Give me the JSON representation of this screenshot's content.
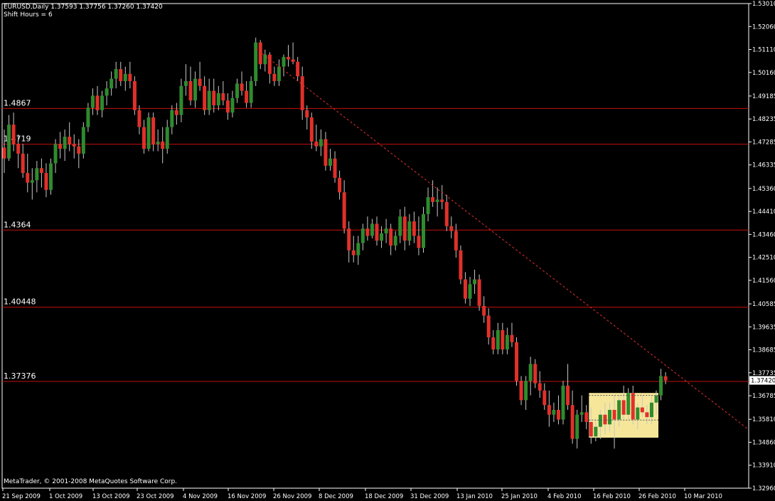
{
  "header": {
    "symbol_line": "EURUSD,Daily  1.37593 1.37756 1.37260 1.37420",
    "shift_line": "Shift Hours = 6"
  },
  "footer": {
    "copyright": "MetaTrader, © 2001-2008 MetaQuotes Software Corp."
  },
  "colors": {
    "background": "#000000",
    "axis": "#ffffff",
    "bull": "#2e8b2e",
    "bear": "#e0302a",
    "wick": "#c8c8c8",
    "hline": "#c41010",
    "trendline": "#e03030",
    "highlight": "#f5e69a",
    "label": "#ffffff"
  },
  "chart_data": {
    "type": "candlestick",
    "ylim": [
      1.3296,
      1.5301
    ],
    "y_ticks": [
      "1.53010",
      "1.52060",
      "1.51110",
      "1.50160",
      "1.49185",
      "1.48235",
      "1.47285",
      "1.46335",
      "1.45360",
      "1.44410",
      "1.43460",
      "1.42510",
      "1.41560",
      "1.40585",
      "1.39635",
      "1.38685",
      "1.37735",
      "1.36785",
      "1.35810",
      "1.34860",
      "1.33910",
      "1.32960"
    ],
    "current_price": "1.37420",
    "x_ticks": [
      "21 Sep 2009",
      "1 Oct 2009",
      "13 Oct 2009",
      "23 Oct 2009",
      "4 Nov 2009",
      "16 Nov 2009",
      "26 Nov 2009",
      "8 Dec 2009",
      "18 Dec 2009",
      "31 Dec 2009",
      "13 Jan 2010",
      "25 Jan 2010",
      "4 Feb 2010",
      "16 Feb 2010",
      "26 Feb 2010",
      "10 Mar 2010"
    ],
    "horizontal_lines": [
      {
        "value": 1.4867,
        "label": "1.4867"
      },
      {
        "value": 1.4719,
        "label": "1.4719"
      },
      {
        "value": 1.4364,
        "label": "1.4364"
      },
      {
        "value": 1.40448,
        "label": "1.40448"
      },
      {
        "value": 1.37376,
        "label": "1.37376"
      }
    ],
    "trendline": {
      "from": {
        "bar": 54,
        "price": 1.5115
      },
      "to": {
        "bar": 149,
        "price": 1.37
      }
    },
    "highlight_box": {
      "from_bar": 126,
      "to_bar": 140,
      "top": 1.369,
      "bottom": 1.3505
    },
    "candles": [
      [
        1.4705,
        1.478,
        1.46,
        1.466
      ],
      [
        1.466,
        1.484,
        1.465,
        1.48
      ],
      [
        1.48,
        1.485,
        1.469,
        1.472
      ],
      [
        1.472,
        1.476,
        1.462,
        1.468
      ],
      [
        1.468,
        1.472,
        1.458,
        1.46
      ],
      [
        1.46,
        1.468,
        1.452,
        1.456
      ],
      [
        1.456,
        1.462,
        1.449,
        1.457
      ],
      [
        1.457,
        1.465,
        1.452,
        1.462
      ],
      [
        1.462,
        1.466,
        1.454,
        1.46
      ],
      [
        1.46,
        1.464,
        1.45,
        1.453
      ],
      [
        1.453,
        1.466,
        1.451,
        1.464
      ],
      [
        1.464,
        1.474,
        1.46,
        1.472
      ],
      [
        1.472,
        1.477,
        1.466,
        1.47
      ],
      [
        1.47,
        1.478,
        1.465,
        1.475
      ],
      [
        1.475,
        1.481,
        1.469,
        1.472
      ],
      [
        1.472,
        1.476,
        1.466,
        1.471
      ],
      [
        1.471,
        1.474,
        1.462,
        1.468
      ],
      [
        1.468,
        1.481,
        1.466,
        1.479
      ],
      [
        1.479,
        1.489,
        1.477,
        1.487
      ],
      [
        1.487,
        1.495,
        1.484,
        1.492
      ],
      [
        1.492,
        1.496,
        1.484,
        1.486
      ],
      [
        1.486,
        1.494,
        1.483,
        1.492
      ],
      [
        1.492,
        1.498,
        1.488,
        1.495
      ],
      [
        1.495,
        1.502,
        1.492,
        1.499
      ],
      [
        1.499,
        1.506,
        1.495,
        1.503
      ],
      [
        1.503,
        1.506,
        1.496,
        1.498
      ],
      [
        1.498,
        1.504,
        1.494,
        1.501
      ],
      [
        1.501,
        1.506,
        1.495,
        1.498
      ],
      [
        1.498,
        1.5,
        1.484,
        1.486
      ],
      [
        1.486,
        1.488,
        1.476,
        1.479
      ],
      [
        1.479,
        1.482,
        1.468,
        1.47
      ],
      [
        1.47,
        1.485,
        1.469,
        1.483
      ],
      [
        1.483,
        1.485,
        1.469,
        1.472
      ],
      [
        1.472,
        1.478,
        1.469,
        1.473
      ],
      [
        1.473,
        1.479,
        1.464,
        1.47
      ],
      [
        1.47,
        1.482,
        1.468,
        1.479
      ],
      [
        1.479,
        1.488,
        1.476,
        1.486
      ],
      [
        1.486,
        1.489,
        1.48,
        1.484
      ],
      [
        1.484,
        1.499,
        1.481,
        1.496
      ],
      [
        1.496,
        1.505,
        1.492,
        1.498
      ],
      [
        1.498,
        1.504,
        1.488,
        1.49
      ],
      [
        1.49,
        1.502,
        1.487,
        1.499
      ],
      [
        1.499,
        1.506,
        1.494,
        1.496
      ],
      [
        1.496,
        1.5,
        1.484,
        1.486
      ],
      [
        1.486,
        1.499,
        1.484,
        1.494
      ],
      [
        1.494,
        1.499,
        1.485,
        1.488
      ],
      [
        1.488,
        1.496,
        1.486,
        1.493
      ],
      [
        1.493,
        1.498,
        1.488,
        1.49
      ],
      [
        1.49,
        1.493,
        1.482,
        1.485
      ],
      [
        1.485,
        1.494,
        1.483,
        1.491
      ],
      [
        1.491,
        1.499,
        1.489,
        1.497
      ],
      [
        1.497,
        1.502,
        1.492,
        1.494
      ],
      [
        1.494,
        1.498,
        1.487,
        1.489
      ],
      [
        1.489,
        1.5,
        1.487,
        1.498
      ],
      [
        1.498,
        1.516,
        1.496,
        1.514
      ],
      [
        1.514,
        1.515,
        1.503,
        1.505
      ],
      [
        1.505,
        1.511,
        1.502,
        1.509
      ],
      [
        1.509,
        1.51,
        1.497,
        1.501
      ],
      [
        1.501,
        1.504,
        1.496,
        1.498
      ],
      [
        1.498,
        1.507,
        1.496,
        1.504
      ],
      [
        1.504,
        1.509,
        1.5,
        1.508
      ],
      [
        1.508,
        1.513,
        1.504,
        1.507
      ],
      [
        1.507,
        1.514,
        1.505,
        1.506
      ],
      [
        1.506,
        1.508,
        1.498,
        1.5
      ],
      [
        1.5,
        1.504,
        1.482,
        1.486
      ],
      [
        1.486,
        1.488,
        1.478,
        1.483
      ],
      [
        1.483,
        1.485,
        1.47,
        1.473
      ],
      [
        1.473,
        1.48,
        1.469,
        1.471
      ],
      [
        1.471,
        1.478,
        1.467,
        1.474
      ],
      [
        1.474,
        1.477,
        1.461,
        1.463
      ],
      [
        1.463,
        1.47,
        1.461,
        1.466
      ],
      [
        1.466,
        1.469,
        1.456,
        1.458
      ],
      [
        1.458,
        1.461,
        1.449,
        1.452
      ],
      [
        1.452,
        1.457,
        1.435,
        1.437
      ],
      [
        1.437,
        1.44,
        1.423,
        1.428
      ],
      [
        1.428,
        1.434,
        1.423,
        1.426
      ],
      [
        1.426,
        1.434,
        1.422,
        1.431
      ],
      [
        1.431,
        1.439,
        1.428,
        1.437
      ],
      [
        1.437,
        1.442,
        1.432,
        1.434
      ],
      [
        1.434,
        1.441,
        1.433,
        1.439
      ],
      [
        1.439,
        1.442,
        1.43,
        1.432
      ],
      [
        1.432,
        1.438,
        1.429,
        1.435
      ],
      [
        1.435,
        1.441,
        1.431,
        1.437
      ],
      [
        1.437,
        1.439,
        1.426,
        1.43
      ],
      [
        1.43,
        1.436,
        1.428,
        1.434
      ],
      [
        1.434,
        1.445,
        1.431,
        1.442
      ],
      [
        1.442,
        1.446,
        1.428,
        1.432
      ],
      [
        1.432,
        1.443,
        1.43,
        1.44
      ],
      [
        1.44,
        1.444,
        1.431,
        1.434
      ],
      [
        1.434,
        1.442,
        1.426,
        1.429
      ],
      [
        1.429,
        1.446,
        1.427,
        1.443
      ],
      [
        1.443,
        1.454,
        1.44,
        1.45
      ],
      [
        1.45,
        1.457,
        1.446,
        1.448
      ],
      [
        1.448,
        1.454,
        1.442,
        1.449
      ],
      [
        1.449,
        1.455,
        1.445,
        1.448
      ],
      [
        1.448,
        1.451,
        1.436,
        1.438
      ],
      [
        1.438,
        1.442,
        1.433,
        1.436
      ],
      [
        1.436,
        1.439,
        1.425,
        1.428
      ],
      [
        1.428,
        1.43,
        1.414,
        1.416
      ],
      [
        1.416,
        1.419,
        1.406,
        1.408
      ],
      [
        1.408,
        1.417,
        1.405,
        1.414
      ],
      [
        1.414,
        1.42,
        1.41,
        1.416
      ],
      [
        1.416,
        1.418,
        1.403,
        1.405
      ],
      [
        1.405,
        1.409,
        1.398,
        1.401
      ],
      [
        1.401,
        1.404,
        1.389,
        1.392
      ],
      [
        1.392,
        1.395,
        1.385,
        1.387
      ],
      [
        1.387,
        1.398,
        1.385,
        1.395
      ],
      [
        1.395,
        1.398,
        1.385,
        1.387
      ],
      [
        1.387,
        1.396,
        1.385,
        1.393
      ],
      [
        1.393,
        1.398,
        1.388,
        1.39
      ],
      [
        1.39,
        1.392,
        1.372,
        1.374
      ],
      [
        1.374,
        1.376,
        1.364,
        1.366
      ],
      [
        1.366,
        1.376,
        1.362,
        1.374
      ],
      [
        1.374,
        1.384,
        1.368,
        1.381
      ],
      [
        1.381,
        1.383,
        1.371,
        1.373
      ],
      [
        1.373,
        1.378,
        1.367,
        1.37
      ],
      [
        1.37,
        1.373,
        1.362,
        1.364
      ],
      [
        1.364,
        1.37,
        1.355,
        1.36
      ],
      [
        1.36,
        1.365,
        1.357,
        1.362
      ],
      [
        1.362,
        1.368,
        1.356,
        1.358
      ],
      [
        1.358,
        1.374,
        1.356,
        1.372
      ],
      [
        1.372,
        1.381,
        1.362,
        1.364
      ],
      [
        1.364,
        1.37,
        1.348,
        1.35
      ],
      [
        1.35,
        1.362,
        1.346,
        1.36
      ],
      [
        1.36,
        1.368,
        1.357,
        1.361
      ],
      [
        1.361,
        1.364,
        1.354,
        1.357
      ],
      [
        1.357,
        1.363,
        1.348,
        1.351
      ],
      [
        1.351,
        1.358,
        1.349,
        1.355
      ],
      [
        1.355,
        1.362,
        1.35,
        1.36
      ],
      [
        1.36,
        1.365,
        1.352,
        1.356
      ],
      [
        1.356,
        1.365,
        1.353,
        1.362
      ],
      [
        1.362,
        1.368,
        1.346,
        1.358
      ],
      [
        1.358,
        1.368,
        1.355,
        1.366
      ],
      [
        1.366,
        1.372,
        1.358,
        1.36
      ],
      [
        1.36,
        1.371,
        1.358,
        1.369
      ],
      [
        1.369,
        1.372,
        1.356,
        1.358
      ],
      [
        1.358,
        1.365,
        1.354,
        1.363
      ],
      [
        1.363,
        1.368,
        1.359,
        1.361
      ],
      [
        1.361,
        1.364,
        1.356,
        1.359
      ],
      [
        1.359,
        1.368,
        1.356,
        1.365
      ],
      [
        1.365,
        1.37,
        1.36,
        1.368
      ],
      [
        1.368,
        1.379,
        1.366,
        1.376
      ],
      [
        1.3759,
        1.3776,
        1.3726,
        1.3742
      ]
    ]
  }
}
